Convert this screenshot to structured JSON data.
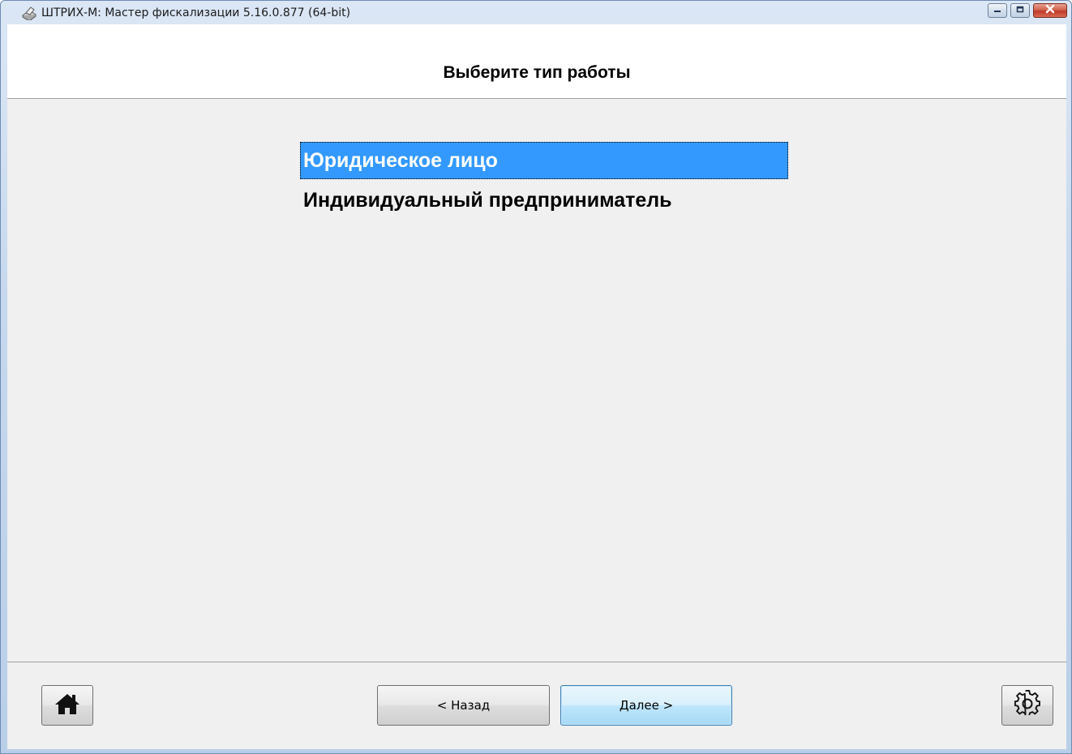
{
  "window": {
    "title": "ШТРИХ-М: Мастер фискализации 5.16.0.877 (64-bit)",
    "controls": [
      "minimize-icon",
      "maximize-icon",
      "close-icon"
    ]
  },
  "header": {
    "title": "Выберите тип работы"
  },
  "options": {
    "selected_index": 0,
    "items": [
      {
        "label": "Юридическое лицо"
      },
      {
        "label": "Индивидуальный предприниматель"
      }
    ]
  },
  "footer": {
    "home_icon": "home-icon",
    "back_label": "< Назад",
    "next_label": "Далее >",
    "settings_icon": "gear-icon"
  },
  "colors": {
    "selection": "#3399ff",
    "client_bg": "#f0f0f0",
    "default_button_border": "#3c7fb1"
  }
}
